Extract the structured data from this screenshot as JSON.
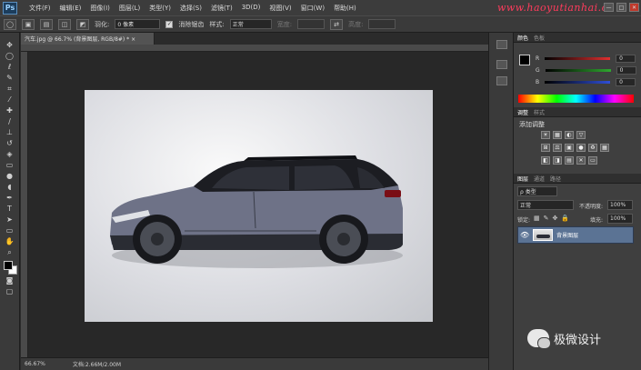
{
  "app": {
    "logo": "Ps"
  },
  "menu": [
    "文件(F)",
    "编辑(E)",
    "图像(I)",
    "图层(L)",
    "类型(Y)",
    "选择(S)",
    "滤镜(T)",
    "3D(D)",
    "视图(V)",
    "窗口(W)",
    "帮助(H)"
  ],
  "watermark": "www.haoyutianhai.cc",
  "window_controls": [
    "—",
    "□",
    "✕"
  ],
  "options": {
    "feather_label": "羽化:",
    "feather_value": "0 像素",
    "antialias_label": "消除锯齿",
    "style_label": "样式:",
    "style_value": "正常",
    "width_label": "宽度:",
    "height_label": "高度:"
  },
  "document": {
    "tab_title": "汽车.jpg @ 66.7% (背景图层, RGB/8#) *  ×",
    "status_zoom": "66.67%",
    "status_doc": "文档:2.66M/2.00M"
  },
  "color_panel": {
    "tabs": [
      "颜色",
      "色板"
    ],
    "channels": [
      {
        "label": "R",
        "value": "0",
        "color": "#e03030"
      },
      {
        "label": "G",
        "value": "0",
        "color": "#2fa82f"
      },
      {
        "label": "B",
        "value": "0",
        "color": "#2f4fd8"
      }
    ]
  },
  "adjustments_panel": {
    "tabs": [
      "调整",
      "样式"
    ],
    "title": "添加调整",
    "row1": [
      "☀",
      "▦",
      "◐",
      "▽"
    ],
    "row2": [
      "⊞",
      "⚖",
      "▣",
      "●",
      "♻",
      "▦"
    ],
    "row3": [
      "◧",
      "◨",
      "▤",
      "✕",
      "▭"
    ]
  },
  "layers_panel": {
    "tabs": [
      "图层",
      "通道",
      "路径"
    ],
    "filter_label": "ρ 类型",
    "blend_mode": "正常",
    "opacity_label": "不透明度:",
    "opacity_value": "100%",
    "lock_label": "锁定:",
    "fill_label": "填充:",
    "fill_value": "100%",
    "layers": [
      {
        "name": "背景图层"
      }
    ]
  },
  "brand": {
    "name": "极微设计"
  },
  "colors": {
    "accent": "#5b7394",
    "watermark": "#ff3b5c"
  }
}
